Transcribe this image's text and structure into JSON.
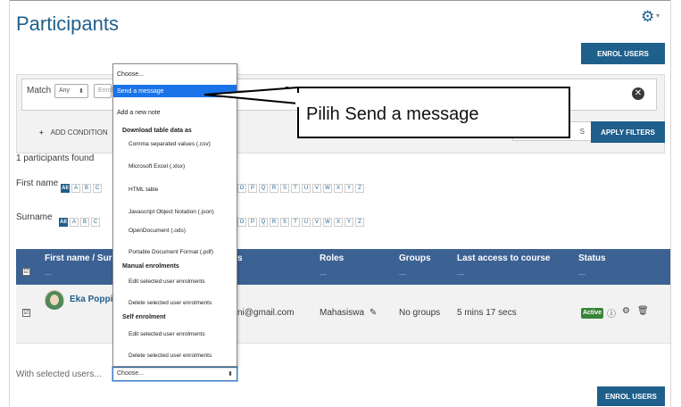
{
  "header": {
    "title": "Participants",
    "enrol_label": "ENROL USERS"
  },
  "filters": {
    "match_label": "Match",
    "match_value": "Any",
    "field_placeholder": "Enrol",
    "add_condition": "ADD CONDITION",
    "clear_label": "S",
    "apply_label": "APPLY FILTERS"
  },
  "found_text": "1 participants found",
  "firstname_filter": {
    "label": "First name",
    "all": "All",
    "left_letters": [
      "A",
      "B",
      "C"
    ],
    "right_letters": [
      "O",
      "P",
      "Q",
      "R",
      "S",
      "T",
      "U",
      "V",
      "W",
      "X",
      "Y",
      "Z"
    ]
  },
  "surname_filter": {
    "label": "Surname",
    "all": "All",
    "left_letters": [
      "A",
      "B",
      "C"
    ],
    "right_letters": [
      "O",
      "P",
      "Q",
      "R",
      "S",
      "T",
      "U",
      "V",
      "W",
      "X",
      "Y",
      "Z"
    ]
  },
  "table": {
    "headers": {
      "name": "First name / Sur",
      "email": "s",
      "roles": "Roles",
      "groups": "Groups",
      "last_access": "Last access to course",
      "status": "Status"
    },
    "dash": "—",
    "row": {
      "name": "Eka Poppi",
      "email": "ni@gmail.com",
      "role": "Mahasiswa",
      "groups": "No groups",
      "last_access": "5 mins 17 secs",
      "status": "Active"
    }
  },
  "bulk": {
    "label": "With selected users...",
    "select_value": "Choose..."
  },
  "dropdown": {
    "choose": "Choose...",
    "send_message": "Send a message",
    "add_note": "Add a new note",
    "download_group": "Download table data as",
    "downloads": [
      "Comma separated values (.csv)",
      "Microsoft Excel (.xlsx)",
      "HTML table",
      "Javascript Object Notation (.json)",
      "OpenDocument (.ods)",
      "Portable Document Format (.pdf)"
    ],
    "manual_group": "Manual enrolments",
    "manual_items": [
      "Edit selected user enrolments",
      "Delete selected user enrolments"
    ],
    "self_group": "Self enrolment",
    "self_items": [
      "Edit selected user enrolments",
      "Delete selected user enrolments"
    ]
  },
  "callout": {
    "text": "Pilih Send a message"
  },
  "colors": {
    "brand": "#1f5f8b",
    "table_header": "#3c6193",
    "highlight": "#1a73e8",
    "active_badge": "#398439"
  }
}
